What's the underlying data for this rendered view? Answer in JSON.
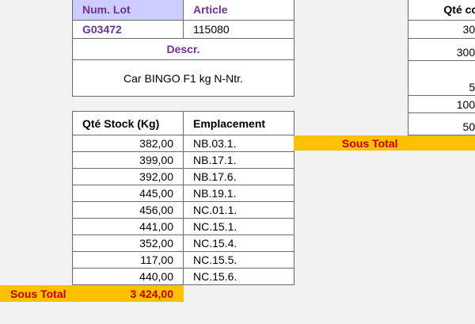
{
  "top_table": {
    "lot_header": "Num. Lot",
    "article_header": "Article",
    "lot_value": "G03472",
    "article_value": "115080",
    "descr_header": "Descr.",
    "descr_value": "Car BINGO F1 kg N-Ntr."
  },
  "stock_table": {
    "col_qty": "Qté Stock (Kg)",
    "col_location": "Emplacement",
    "rows": [
      {
        "qty": "382,00",
        "loc": "NB.03.1."
      },
      {
        "qty": "399,00",
        "loc": "NB.17.1."
      },
      {
        "qty": "392,00",
        "loc": "NB.17.6."
      },
      {
        "qty": "445,00",
        "loc": "NB.19.1."
      },
      {
        "qty": "456,00",
        "loc": "NC.01.1."
      },
      {
        "qty": "441,00",
        "loc": "NC.15.1."
      },
      {
        "qty": "352,00",
        "loc": "NC.15.4."
      },
      {
        "qty": "117,00",
        "loc": "NC.15.5."
      },
      {
        "qty": "440,00",
        "loc": "NC.15.6."
      }
    ],
    "subtotal_label": "Sous Total",
    "subtotal_value": "3 424,00"
  },
  "right_table": {
    "header_partial": "Qté co",
    "values_partial": [
      "30,",
      "300,",
      "5,",
      "100,",
      "50,"
    ],
    "subtotal_label": "Sous Total"
  },
  "colors": {
    "header_text": "#7030a0",
    "lot_header_bg": "#ccccff",
    "subtotal_bg": "#ffc000",
    "subtotal_text": "#c00000"
  }
}
